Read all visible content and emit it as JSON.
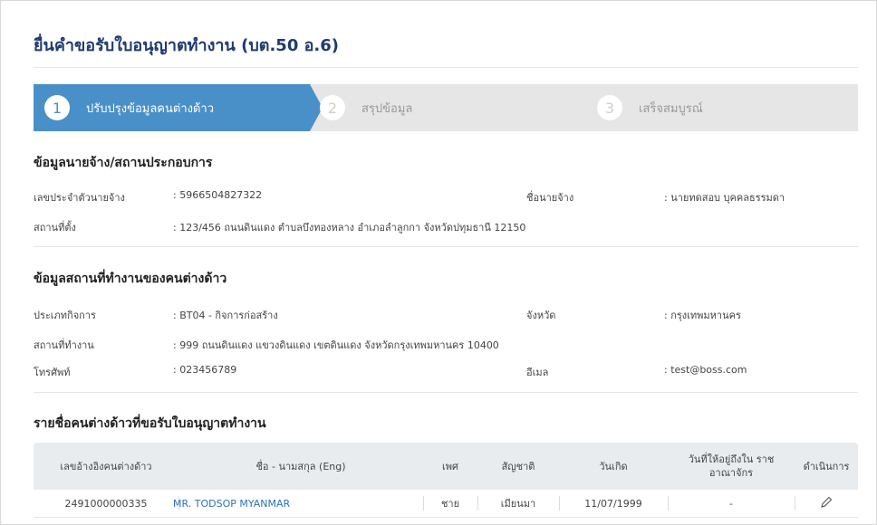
{
  "page": {
    "title": "ยื่นคำขอรับใบอนุญาตทำงาน (บต.50 อ.6)"
  },
  "steps": [
    {
      "number": "1",
      "label": "ปรับปรุงข้อมูลคนต่างด้าว",
      "active": true
    },
    {
      "number": "2",
      "label": "สรุปข้อมูล",
      "active": false
    },
    {
      "number": "3",
      "label": "เสร็จสมบูรณ์",
      "active": false
    }
  ],
  "employer": {
    "heading": "ข้อมูลนายจ้าง/สถานประกอบการ",
    "id_label": "เลขประจำตัวนายจ้าง",
    "id_value": ": 5966504827322",
    "name_label": "ชื่อนายจ้าง",
    "name_value": ": นายทดสอบ บุคคลธรรมดา",
    "address_label": "สถานที่ตั้ง",
    "address_value": ": 123/456 ถนนดินแดง ตำบลบึงทองหลาง อำเภอลำลูกกา จังหวัดปทุมธานี 12150"
  },
  "workplace": {
    "heading": "ข้อมูลสถานที่ทำงานของคนต่างด้าว",
    "business_label": "ประเภทกิจการ",
    "business_value": ": BT04 - กิจการก่อสร้าง",
    "province_label": "จังหวัด",
    "province_value": ": กรุงเทพมหานคร",
    "location_label": "สถานที่ทำงาน",
    "location_value": ": 999 ถนนดินแดง แขวงดินแดง เขตดินแดง จังหวัดกรุงเทพมหานคร 10400",
    "phone_label": "โทรศัพท์",
    "phone_value": ": 023456789",
    "email_label": "อีเมล",
    "email_value": ": test@boss.com"
  },
  "workers": {
    "heading": "รายชื่อคนต่างด้าวที่ขอรับใบอนุญาตทำงาน",
    "columns": [
      "เลขอ้างอิงคนต่างด้าว",
      "ชื่อ - นามสกุล (Eng)",
      "เพศ",
      "สัญชาติ",
      "วันเกิด",
      "วันที่ให้อยู่ถึงใน ราชอาณาจักร",
      "ดำเนินการ"
    ],
    "rows": [
      {
        "ref": "2491000000335",
        "name": "MR. TODSOP MYANMAR",
        "sex": "ชาย",
        "nationality": "เมียนมา",
        "dob": "11/07/1999",
        "stay_until": "-",
        "action_icon": "pencil-icon"
      }
    ]
  },
  "colors": {
    "accent": "#4a90c8",
    "title": "#1f3b70",
    "link": "#2a73b6",
    "step_inactive_bg": "#e6e6e6"
  }
}
